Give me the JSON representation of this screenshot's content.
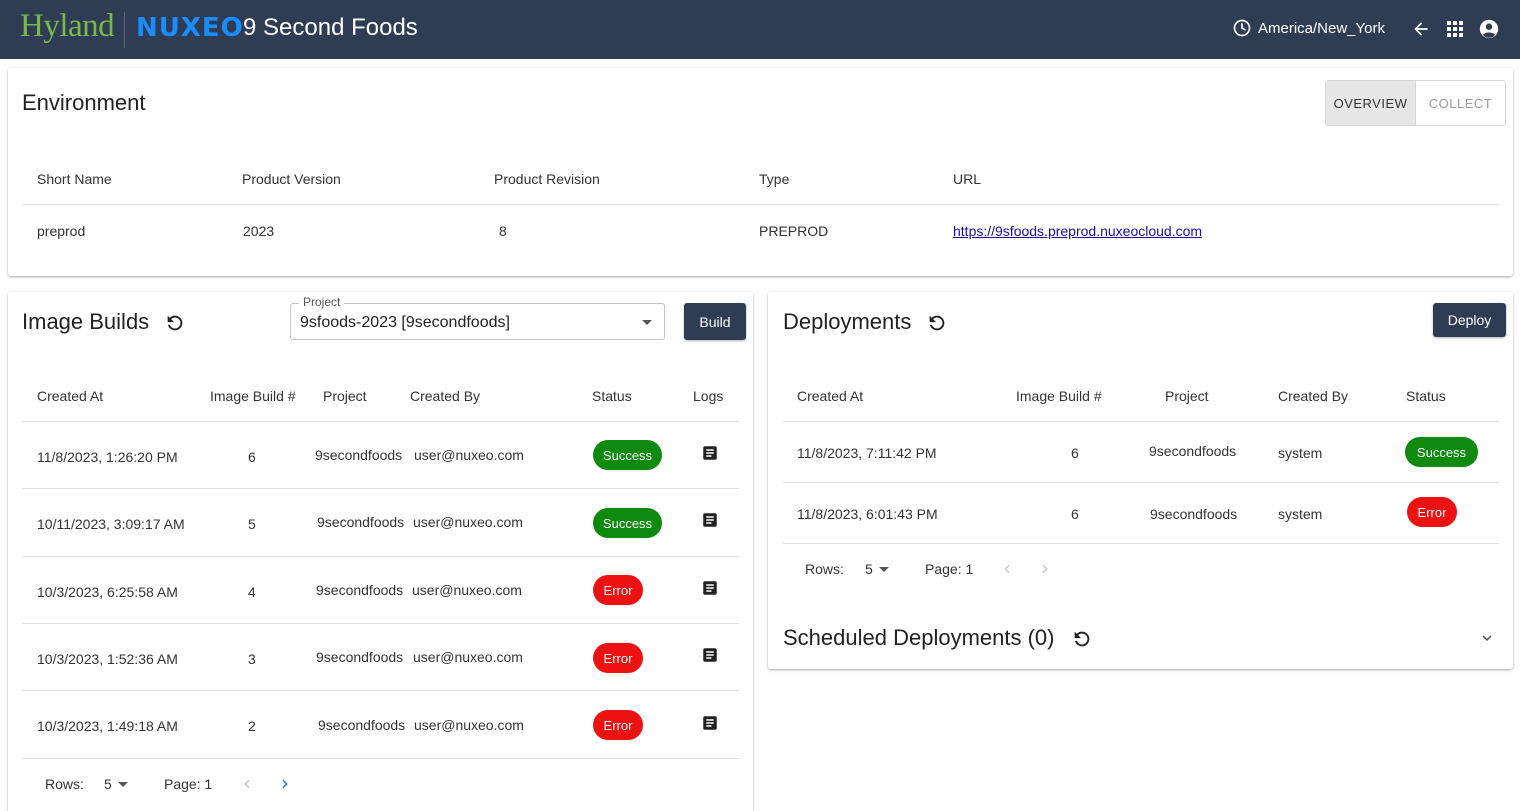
{
  "header": {
    "brand_hyland": "Hyland",
    "brand_nuxeo": "NUXEO",
    "title": "9 Second Foods",
    "timezone": "America/New_York",
    "icons": [
      "clock-icon",
      "back-arrow-icon",
      "apps-grid-icon",
      "account-icon"
    ]
  },
  "environment": {
    "title": "Environment",
    "tabs": {
      "overview": "OVERVIEW",
      "collect": "COLLECT"
    },
    "columns": {
      "short_name": "Short Name",
      "product_version": "Product Version",
      "product_revision": "Product Revision",
      "type": "Type",
      "url": "URL"
    },
    "row": {
      "short_name": "preprod",
      "product_version": "2023",
      "product_revision": "8",
      "type": "PREPROD",
      "url": "https://9sfoods.preprod.nuxeocloud.com"
    }
  },
  "image_builds": {
    "title": "Image Builds",
    "project_label": "Project",
    "project_value": "9sfoods-2023 [9secondfoods]",
    "build_label": "Build",
    "columns": {
      "created_at": "Created At",
      "build_num": "Image Build #",
      "project": "Project",
      "created_by": "Created By",
      "status": "Status",
      "logs": "Logs"
    },
    "rows": [
      {
        "created_at": "11/8/2023, 1:26:20 PM",
        "build_num": "6",
        "project": "9secondfoods",
        "created_by": "user@nuxeo.com",
        "status": "Success"
      },
      {
        "created_at": "10/11/2023, 3:09:17 AM",
        "build_num": "5",
        "project": "9secondfoods",
        "created_by": "user@nuxeo.com",
        "status": "Success"
      },
      {
        "created_at": "10/3/2023, 6:25:58 AM",
        "build_num": "4",
        "project": "9secondfoods",
        "created_by": "user@nuxeo.com",
        "status": "Error"
      },
      {
        "created_at": "10/3/2023, 1:52:36 AM",
        "build_num": "3",
        "project": "9secondfoods",
        "created_by": "user@nuxeo.com",
        "status": "Error"
      },
      {
        "created_at": "10/3/2023, 1:49:18 AM",
        "build_num": "2",
        "project": "9secondfoods",
        "created_by": "user@nuxeo.com",
        "status": "Error"
      }
    ],
    "pager": {
      "rows_label": "Rows:",
      "rows_value": "5",
      "page_label": "Page: 1"
    }
  },
  "deployments": {
    "title": "Deployments",
    "deploy_label": "Deploy",
    "columns": {
      "created_at": "Created At",
      "build_num": "Image Build #",
      "project": "Project",
      "created_by": "Created By",
      "status": "Status"
    },
    "rows": [
      {
        "created_at": "11/8/2023, 7:11:42 PM",
        "build_num": "6",
        "project": "9secondfoods",
        "created_by": "system",
        "status": "Success"
      },
      {
        "created_at": "11/8/2023, 6:01:43 PM",
        "build_num": "6",
        "project": "9secondfoods",
        "created_by": "system",
        "status": "Error"
      }
    ],
    "pager": {
      "rows_label": "Rows:",
      "rows_value": "5",
      "page_label": "Page: 1"
    }
  },
  "scheduled": {
    "title": "Scheduled Deployments (0)"
  },
  "colors": {
    "header_bg": "#2e3d54",
    "success": "#0e8a0e",
    "error": "#ee1111",
    "hyland_green": "#79b84a",
    "nuxeo_blue": "#1a8cff"
  }
}
